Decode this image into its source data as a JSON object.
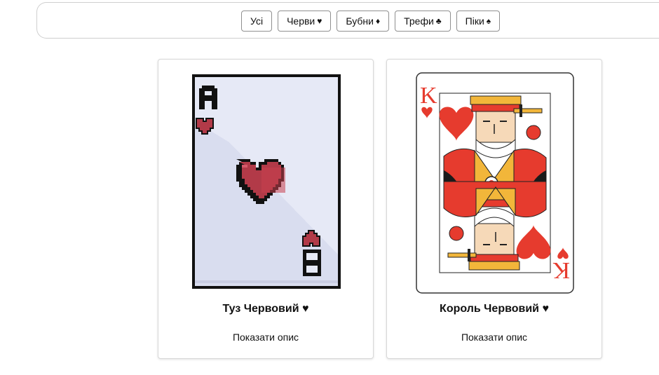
{
  "filters": [
    {
      "label": "Усі",
      "suit": ""
    },
    {
      "label": "Черви",
      "suit": "♥"
    },
    {
      "label": "Бубни",
      "suit": "♦"
    },
    {
      "label": "Трефи",
      "suit": "♣"
    },
    {
      "label": "Піки",
      "suit": "♠"
    }
  ],
  "cards": [
    {
      "name": "Туз Червовий ♥",
      "toggle_label": "Показати опис",
      "rank": "A",
      "image_icon": "pixel-ace-of-hearts"
    },
    {
      "name": "Король Червовий ♥",
      "toggle_label": "Показати опис",
      "rank": "K",
      "image_icon": "king-of-hearts"
    }
  ],
  "colors": {
    "heart_red": "#e63b2e",
    "pixel_heart": "#b23a48",
    "card_bg_pixel": "#e6e9f6"
  }
}
